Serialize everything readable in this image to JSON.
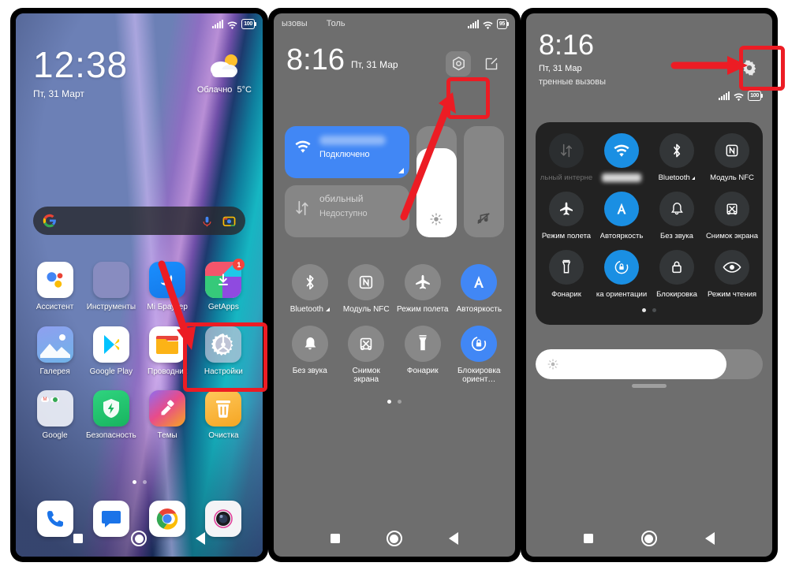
{
  "screens": [
    {
      "id": "home-screen",
      "status": {
        "signal": "signal-icon",
        "wifi": "wifi-icon",
        "battery_level": "100"
      },
      "clock": {
        "time": "12:38",
        "date": "Пт, 31 Март"
      },
      "weather": {
        "condition": "Облачно",
        "temperature": "5°C",
        "icon": "partly-cloudy-icon"
      },
      "search": {
        "logo": "google-g-icon",
        "mic": "microphone-icon",
        "lens": "google-lens-icon",
        "placeholder": ""
      },
      "apps": [
        {
          "label": "Ассистент",
          "icon": "google-assistant-icon"
        },
        {
          "label": "Инструменты",
          "icon": "folder-tools-icon"
        },
        {
          "label": "Mi Браузер",
          "icon": "mi-browser-icon"
        },
        {
          "label": "GetApps",
          "icon": "getapps-icon",
          "badge": "1"
        },
        {
          "label": "Галерея",
          "icon": "gallery-icon"
        },
        {
          "label": "Google Play",
          "icon": "google-play-icon"
        },
        {
          "label": "Проводник",
          "icon": "file-manager-icon"
        },
        {
          "label": "Настройки",
          "icon": "settings-gear-icon"
        },
        {
          "label": "Google",
          "icon": "google-folder-icon"
        },
        {
          "label": "Безопасность",
          "icon": "security-shield-icon"
        },
        {
          "label": "Темы",
          "icon": "themes-icon"
        },
        {
          "label": "Очистка",
          "icon": "cleaner-trash-icon"
        }
      ],
      "dock": [
        {
          "label": "Телефон",
          "icon": "phone-icon"
        },
        {
          "label": "Сообщения",
          "icon": "messages-icon"
        },
        {
          "label": "Chrome",
          "icon": "chrome-icon"
        },
        {
          "label": "Камера",
          "icon": "camera-icon"
        }
      ],
      "nav": {
        "recents": "square-icon",
        "home": "circle-icon",
        "back": "triangle-back-icon"
      }
    },
    {
      "id": "notification-shade-light",
      "status": {
        "carrier_left": "ызовы",
        "carrier_right": "Толь",
        "signal": "signal-icon",
        "wifi": "wifi-icon",
        "battery_level": "95"
      },
      "clock": {
        "time": "8:16",
        "date": "Пт, 31 Мар"
      },
      "actions": [
        {
          "name": "settings-hex-button",
          "icon": "hex-gear-icon"
        },
        {
          "name": "edit-button",
          "icon": "edit-pencil-icon"
        }
      ],
      "big_tiles": [
        {
          "label_blurred": true,
          "sub": "Подключено",
          "icon": "wifi-icon",
          "state": "on"
        },
        {
          "label": "обильный",
          "sub": "Недоступно",
          "icon": "mobile-data-icon",
          "state": "off"
        }
      ],
      "sliders": [
        {
          "name": "brightness-slider",
          "icon": "brightness-sun-icon",
          "value": 80
        },
        {
          "name": "volume-slider",
          "icon": "volume-muted-icon",
          "value": 0
        }
      ],
      "quick_tiles": [
        {
          "label": "Bluetooth",
          "icon": "bluetooth-icon",
          "state": "off",
          "expandable": true
        },
        {
          "label": "Модуль NFC",
          "icon": "nfc-icon",
          "state": "off"
        },
        {
          "label": "Режим полета",
          "icon": "airplane-icon",
          "state": "off"
        },
        {
          "label": "Автояркость",
          "icon": "auto-brightness-icon",
          "state": "on"
        },
        {
          "label": "Без звука",
          "icon": "bell-icon",
          "state": "off"
        },
        {
          "label": "Снимок экрана",
          "icon": "screenshot-icon",
          "state": "off"
        },
        {
          "label": "Фонарик",
          "icon": "flashlight-icon",
          "state": "off"
        },
        {
          "label": "Блокировка ориент…",
          "icon": "rotation-lock-icon",
          "state": "on"
        }
      ],
      "page_dots": {
        "count": 2,
        "active": 0
      },
      "nav": {
        "recents": "square-icon",
        "home": "circle-icon",
        "back": "triangle-back-icon"
      }
    },
    {
      "id": "notification-shade-dark",
      "clock": {
        "time": "8:16",
        "date": "Пт, 31 Мар",
        "emergency": "тренные вызовы"
      },
      "status": {
        "signal": "signal-icon",
        "wifi": "wifi-icon",
        "battery_level": "100"
      },
      "settings_button": {
        "name": "settings-gear-button",
        "icon": "gear-icon"
      },
      "quick_tiles": [
        {
          "label": "льный интерне",
          "icon": "mobile-data-icon",
          "state": "dim"
        },
        {
          "label_blurred": true,
          "icon": "wifi-icon",
          "state": "on",
          "expandable": true
        },
        {
          "label": "Bluetooth",
          "icon": "bluetooth-icon",
          "state": "off",
          "expandable": true
        },
        {
          "label": "Модуль NFC",
          "icon": "nfc-icon",
          "state": "off"
        },
        {
          "label": "Режим полета",
          "icon": "airplane-icon",
          "state": "off"
        },
        {
          "label": "Автояркость",
          "icon": "auto-brightness-icon",
          "state": "on"
        },
        {
          "label": "Без звука",
          "icon": "bell-icon",
          "state": "off"
        },
        {
          "label": "Снимок экрана",
          "icon": "screenshot-icon",
          "state": "off"
        },
        {
          "label": "Фонарик",
          "icon": "flashlight-icon",
          "state": "off"
        },
        {
          "label": "ка ориентации",
          "icon": "rotation-lock-icon",
          "state": "on"
        },
        {
          "label": "Блокировка",
          "icon": "lock-icon",
          "state": "off"
        },
        {
          "label": "Режим чтения",
          "icon": "reading-mode-eye-icon",
          "state": "off"
        }
      ],
      "page_dots": {
        "count": 2,
        "active": 0
      },
      "brightness": {
        "name": "brightness-slider",
        "icon": "brightness-sun-icon",
        "value": 84
      },
      "nav": {
        "recents": "square-icon",
        "home": "circle-icon",
        "back": "triangle-back-icon"
      }
    }
  ],
  "annotations": {
    "accent_color": "#ec1c24",
    "marks": [
      {
        "name": "settings-app-highlight",
        "target": "Настройки"
      },
      {
        "name": "settings-hex-highlight",
        "target": "hex-gear-icon"
      },
      {
        "name": "settings-gear-highlight",
        "target": "gear-icon"
      }
    ]
  }
}
